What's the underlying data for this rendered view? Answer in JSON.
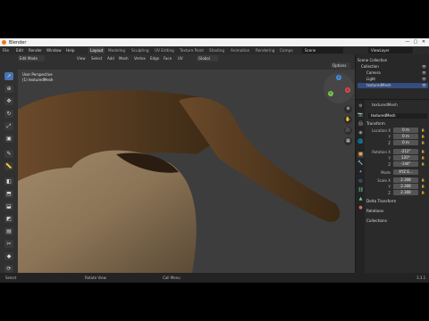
{
  "window": {
    "title": "Blender",
    "controls": [
      "—",
      "▢",
      "✕"
    ]
  },
  "menubar": {
    "mode": "Edit Mode",
    "menus": [
      "File",
      "Edit",
      "Render",
      "Window",
      "Help"
    ],
    "workspaces": [
      "Layout",
      "Modeling",
      "Sculpting",
      "UV Editing",
      "Texture Paint",
      "Shading",
      "Animation",
      "Rendering",
      "Compo"
    ],
    "scene": "Scene",
    "view_layer": "ViewLayer"
  },
  "header3d": {
    "mode": "Edit Mode",
    "menus": [
      "View",
      "Select",
      "Add",
      "Mesh",
      "Vertex",
      "Edge",
      "Face",
      "UV"
    ],
    "transform": "Global",
    "options": "Options"
  },
  "viewport": {
    "perspective": "User Perspective",
    "object": "(1) texturedMesh",
    "gizmo": {
      "x": "X",
      "y": "Y",
      "z": "Z"
    }
  },
  "outliner": {
    "rows": [
      {
        "label": "Scene Collection",
        "selected": false
      },
      {
        "label": "Collection",
        "selected": false
      },
      {
        "label": "Camera",
        "selected": false
      },
      {
        "label": "Light",
        "selected": false
      },
      {
        "label": "texturedMesh",
        "selected": true
      }
    ]
  },
  "properties": {
    "object_name": "texturedMesh",
    "object_field": "texturedMesh",
    "transform_header": "Transform",
    "location_label": "Location X",
    "location": [
      "0 m",
      "0 m",
      "0 m"
    ],
    "rotation_label": "Rotation X",
    "rotation": [
      "-212°",
      "120°",
      "-144°"
    ],
    "mode_label": "Mode",
    "mode_value": "XYZ E...",
    "scale_label": "Scale X",
    "scale": [
      "2.308",
      "2.308",
      "2.308"
    ],
    "axis_labels": [
      "Y",
      "Z"
    ],
    "sections": [
      "Delta Transform",
      "Relations",
      "Collections"
    ]
  },
  "statusbar": {
    "select": "Select",
    "rotate": "Rotate View",
    "call_menu": "Call Menu",
    "version": "3.3.1"
  },
  "colors": {
    "accent": "#4772b3",
    "selection": "#334d80",
    "viewport_bg": "#3d3d3d"
  }
}
